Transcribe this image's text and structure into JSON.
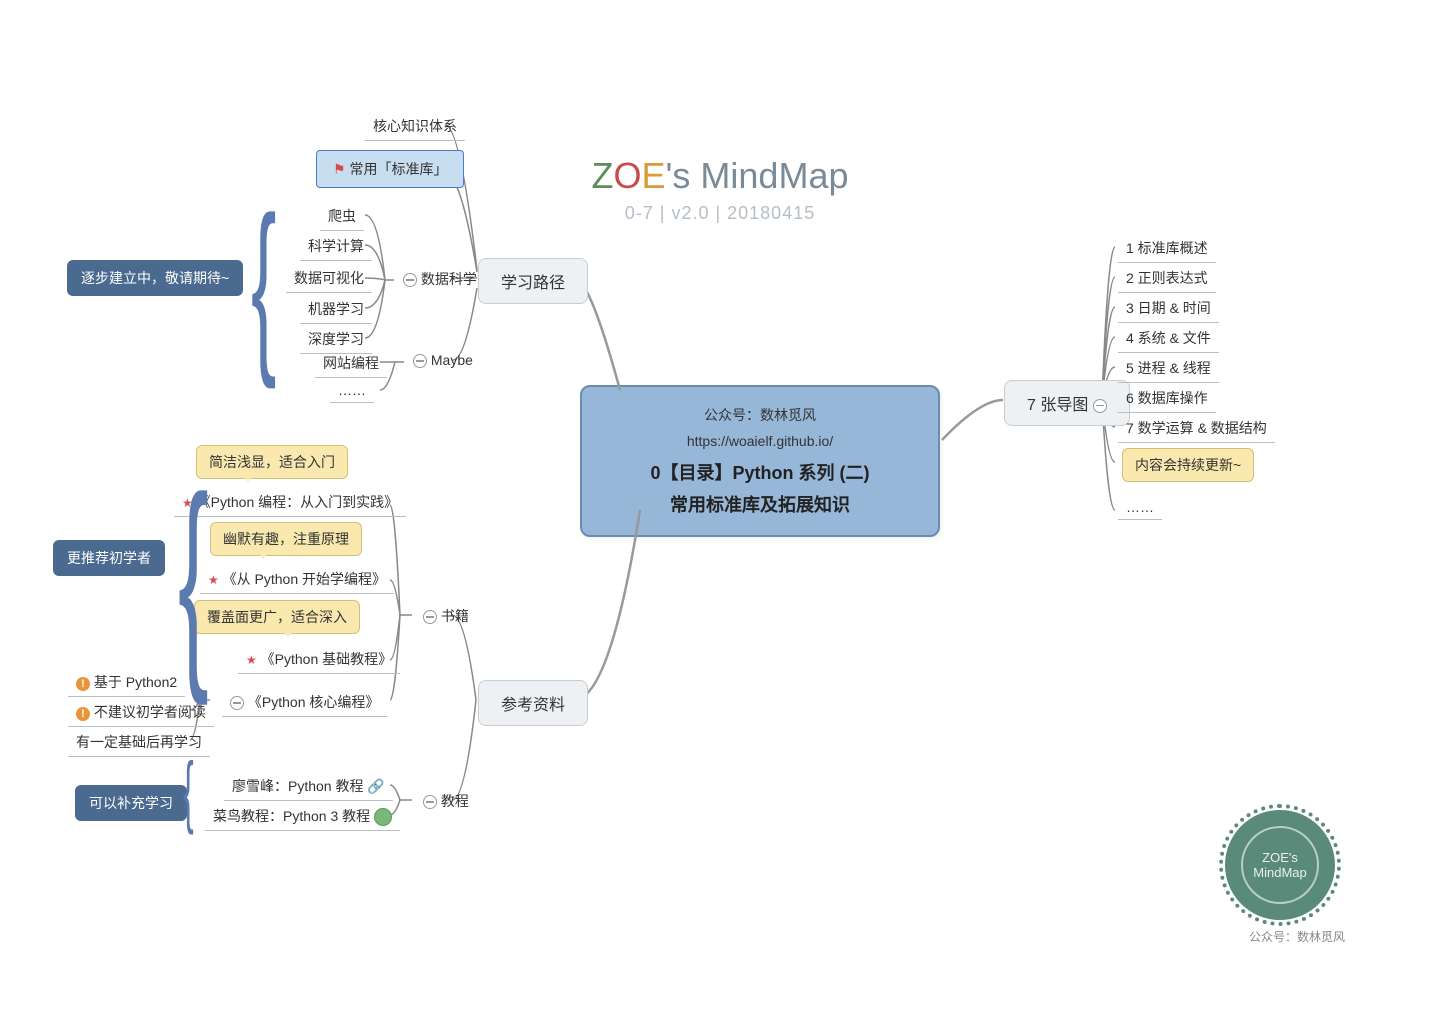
{
  "header": {
    "z": "Z",
    "o": "O",
    "e": "E",
    "rest": "'s MindMap",
    "sub": "0-7 | v2.0 | 20180415"
  },
  "central": {
    "sub1": "公众号：数林觅风",
    "sub2": "https://woaielf.github.io/",
    "main1": "0【目录】Python 系列 (二)",
    "main2": "常用标准库及拓展知识"
  },
  "branches": {
    "learning_path": "学习路径",
    "references": "参考资料",
    "maps": "7 张导图"
  },
  "learning_path": {
    "core_knowledge": "核心知识体系",
    "std_lib": "常用「标准库」",
    "data_science": "数据科学",
    "maybe": "Maybe",
    "ds_items": [
      "爬虫",
      "科学计算",
      "数据可视化",
      "机器学习",
      "深度学习"
    ],
    "maybe_items": [
      "网站编程",
      "……"
    ]
  },
  "references": {
    "books": "书籍",
    "tutorials": "教程",
    "book_items": [
      "《Python 编程：从入门到实践》",
      "《从 Python 开始学编程》",
      "《Python 基础教程》"
    ],
    "book_notes": [
      "简洁浅显，适合入门",
      "幽默有趣，注重原理",
      "覆盖面更广，适合深入"
    ],
    "core_prog": "《Python 核心编程》",
    "core_prog_notes": [
      "基于 Python2",
      "不建议初学者阅读",
      "有一定基础后再学习"
    ],
    "tutorial_items": [
      "廖雪峰：Python 教程",
      "菜鸟教程：Python 3 教程"
    ]
  },
  "maps": {
    "items": [
      "1 标准库概述",
      "2 正则表达式",
      "3 日期 & 时间",
      "4 系统 & 文件",
      "5 进程 & 线程",
      "6 数据库操作",
      "7 数学运算 & 数据结构"
    ],
    "note": "内容会持续更新~",
    "more": "……"
  },
  "badges": {
    "wip": "逐步建立中，敬请期待~",
    "beginner": "更推荐初学者",
    "supplement": "可以补充学习"
  },
  "seal": {
    "line1": "ZOE's",
    "line2": "MindMap",
    "caption": "公众号：数林觅风"
  }
}
